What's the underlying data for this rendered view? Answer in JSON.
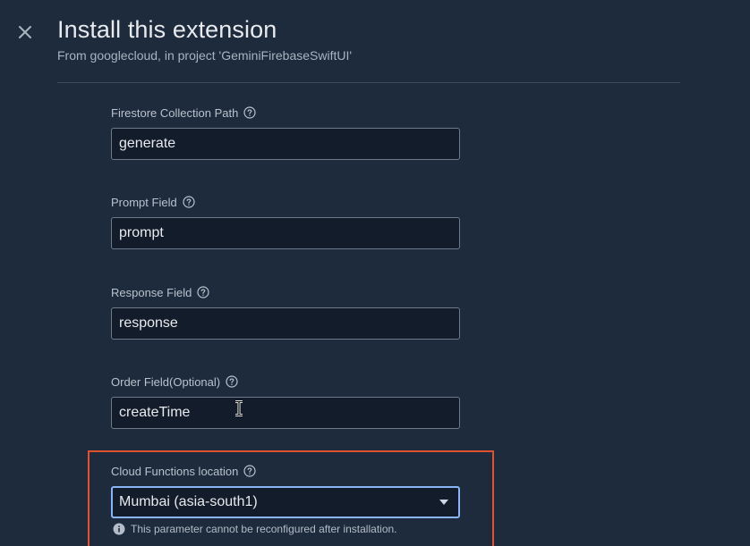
{
  "header": {
    "title": "Install this extension",
    "subtitle": "From googlecloud, in project 'GeminiFirebaseSwiftUI'"
  },
  "fields": {
    "collection_path": {
      "label": "Firestore Collection Path",
      "value": "generate"
    },
    "prompt_field": {
      "label": "Prompt Field",
      "value": "prompt"
    },
    "response_field": {
      "label": "Response Field",
      "value": "response"
    },
    "order_field": {
      "label": "Order Field(Optional)",
      "value": "createTime"
    },
    "location": {
      "label": "Cloud Functions location",
      "selected": "Mumbai (asia-south1)",
      "hint": "This parameter cannot be reconfigured after installation."
    }
  },
  "icons": {
    "close": "close-icon",
    "help": "help-circle-icon",
    "info": "info-icon",
    "dropdown": "chevron-down-icon",
    "cursor": "text-cursor-icon"
  },
  "colors": {
    "background": "#1e2b3d",
    "input_background": "#121c2a",
    "highlight_border": "#e0522f",
    "focus_border": "#8ab4f8"
  }
}
